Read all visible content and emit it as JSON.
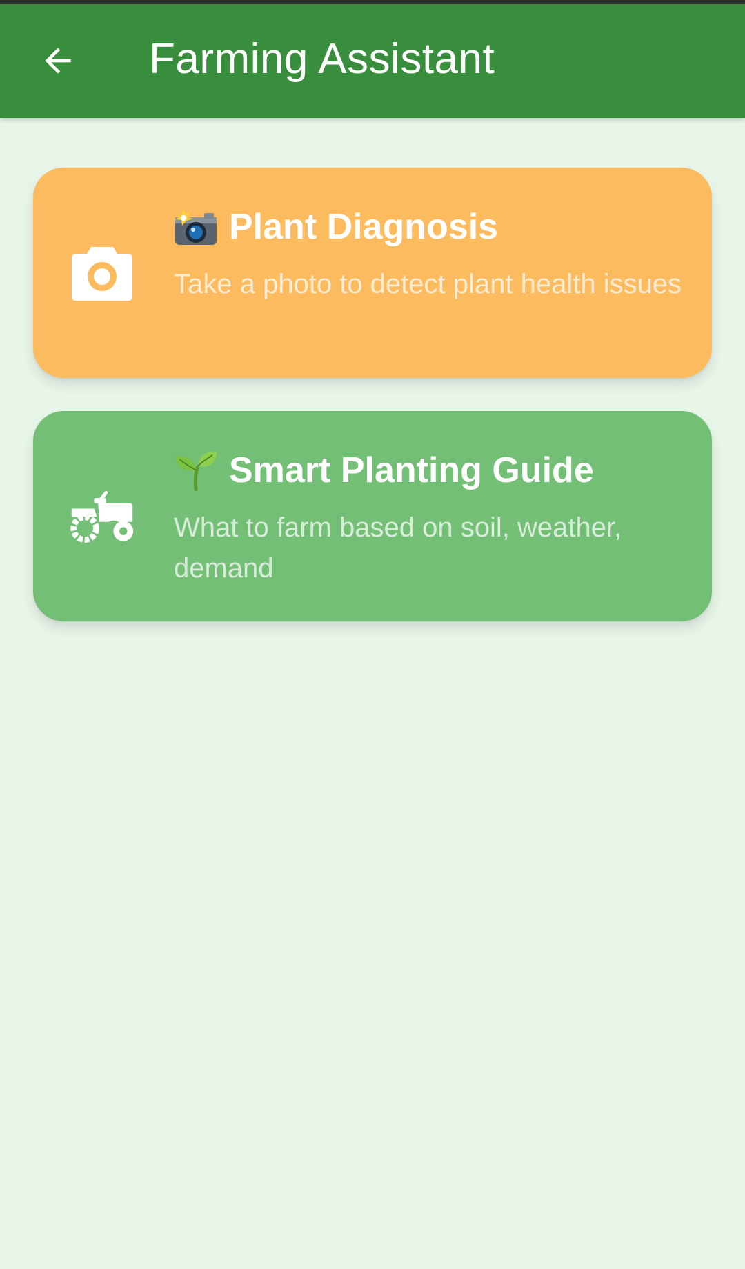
{
  "header": {
    "title": "Farming Assistant",
    "back_icon": "arrow-back-icon",
    "background": "#388e3c"
  },
  "cards": [
    {
      "title": "Plant Diagnosis",
      "title_emoji": "camera-with-flash-emoji",
      "description": "Take a photo to detect plant health issues",
      "icon": "camera-icon",
      "color": "#fcbb5e"
    },
    {
      "title": "Smart Planting Guide",
      "title_emoji": "seedling-emoji",
      "description": "What to farm based on soil, weather, demand",
      "icon": "tractor-icon",
      "color": "#73bf76"
    }
  ],
  "page_background": "#e8f5e9"
}
